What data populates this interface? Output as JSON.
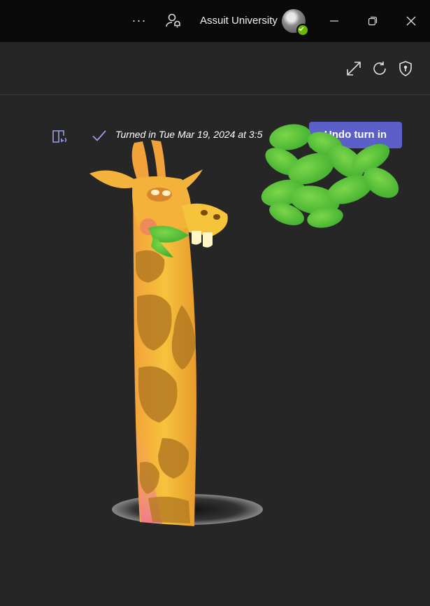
{
  "titlebar": {
    "more_label": "···",
    "organization": "Assuit University",
    "avatar_status": "available"
  },
  "toolbar": {
    "icons": [
      "expand-icon",
      "refresh-icon",
      "shield-icon"
    ]
  },
  "assignment": {
    "status_text": "Turned in Tue Mar 19, 2024 at 3:5",
    "undo_button_label": "Undo turn in"
  },
  "colors": {
    "accent": "#5b5fc7",
    "background": "#262626",
    "titlebar": "#0a0a0a",
    "status_available": "#6bb700"
  }
}
